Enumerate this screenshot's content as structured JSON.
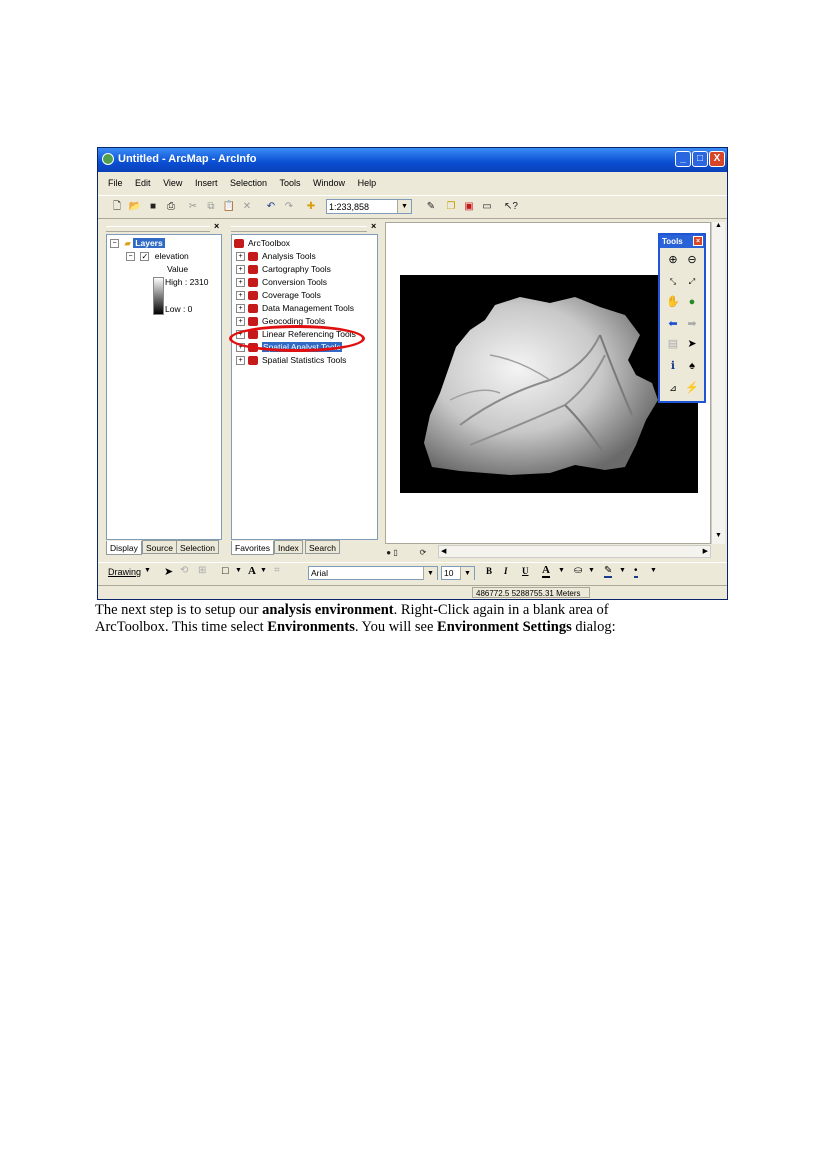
{
  "window": {
    "title": "Untitled - ArcMap - ArcInfo",
    "minimize": "_",
    "maximize": "□",
    "close": "X"
  },
  "menu": [
    "File",
    "Edit",
    "View",
    "Insert",
    "Selection",
    "Tools",
    "Window",
    "Help"
  ],
  "toolbar": {
    "scale": "1:233,858"
  },
  "toc": {
    "root": "Layers",
    "layer": "elevation",
    "legend_title": "Value",
    "high": "High : 2310",
    "low": "Low : 0",
    "tabs": [
      "Display",
      "Source",
      "Selection"
    ]
  },
  "toolbox": {
    "root": "ArcToolbox",
    "items": [
      "Analysis Tools",
      "Cartography Tools",
      "Conversion Tools",
      "Coverage Tools",
      "Data Management Tools",
      "Geocoding Tools",
      "Linear Referencing Tools",
      "Spatial Analyst Tools",
      "Spatial Statistics Tools"
    ],
    "selected_index": 7,
    "tabs": [
      "Favorites",
      "Index",
      "Search"
    ]
  },
  "tools_window": {
    "title": "Tools",
    "icons": [
      "zoom-in-icon",
      "zoom-out-icon",
      "fixed-zoom-in-icon",
      "fixed-zoom-out-icon",
      "pan-icon",
      "full-extent-icon",
      "back-extent-icon",
      "forward-extent-icon",
      "select-features-icon",
      "select-elements-icon",
      "identify-icon",
      "find-icon",
      "measure-icon",
      "hyperlink-icon"
    ]
  },
  "drawing_bar": {
    "drawing": "Drawing",
    "font": "Arial",
    "size": "10",
    "bold": "B",
    "italic": "I",
    "underline": "U",
    "font_color": "A"
  },
  "status": {
    "coords": "486772.5  5288755.31 Meters"
  },
  "caption": {
    "line1_a": "The next step is to setup our ",
    "line1_b": "analysis environment",
    "line1_c": ". Right-Click again in a blank area of",
    "line2_a": "ArcToolbox. This time select ",
    "line2_b": "Environments",
    "line2_c": ". You will see ",
    "line2_d": "Environment Settings",
    "line2_e": " dialog:"
  },
  "colors": {
    "title_blue": "#0a4fd3",
    "selection": "#316ac5",
    "highlight_ellipse": "#e01010",
    "tool_red": "#c41a1a"
  }
}
